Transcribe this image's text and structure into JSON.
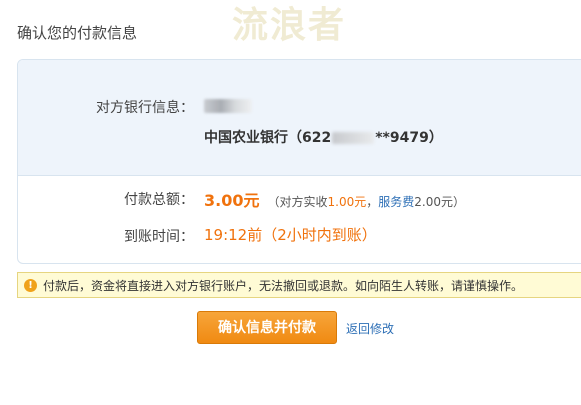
{
  "watermark": "流浪者",
  "page_title": "确认您的付款信息",
  "bank": {
    "label": "对方银行信息：",
    "bank_name": "中国农业银行",
    "account_prefix": "622",
    "account_suffix": "**9479"
  },
  "payment": {
    "amount_label": "付款总额：",
    "amount": "3.00元",
    "detail_open": "（对方实收",
    "received": "1.00元",
    "sep": "，",
    "fee_label": "服务费",
    "fee": "2.00元",
    "detail_close": "）"
  },
  "arrival": {
    "label": "到账时间：",
    "value": "19:12前（2小时内到账）"
  },
  "notice": {
    "icon": "warning-icon",
    "text": "付款后，资金将直接进入对方银行账户，无法撤回或退款。如向陌生人转账，请谨慎操作。"
  },
  "actions": {
    "confirm_label": "确认信息并付款",
    "back_label": "返回修改"
  },
  "colors": {
    "accent_orange": "#f0720d",
    "link_blue": "#2d6fb6",
    "notice_bg": "#fffbd5"
  }
}
